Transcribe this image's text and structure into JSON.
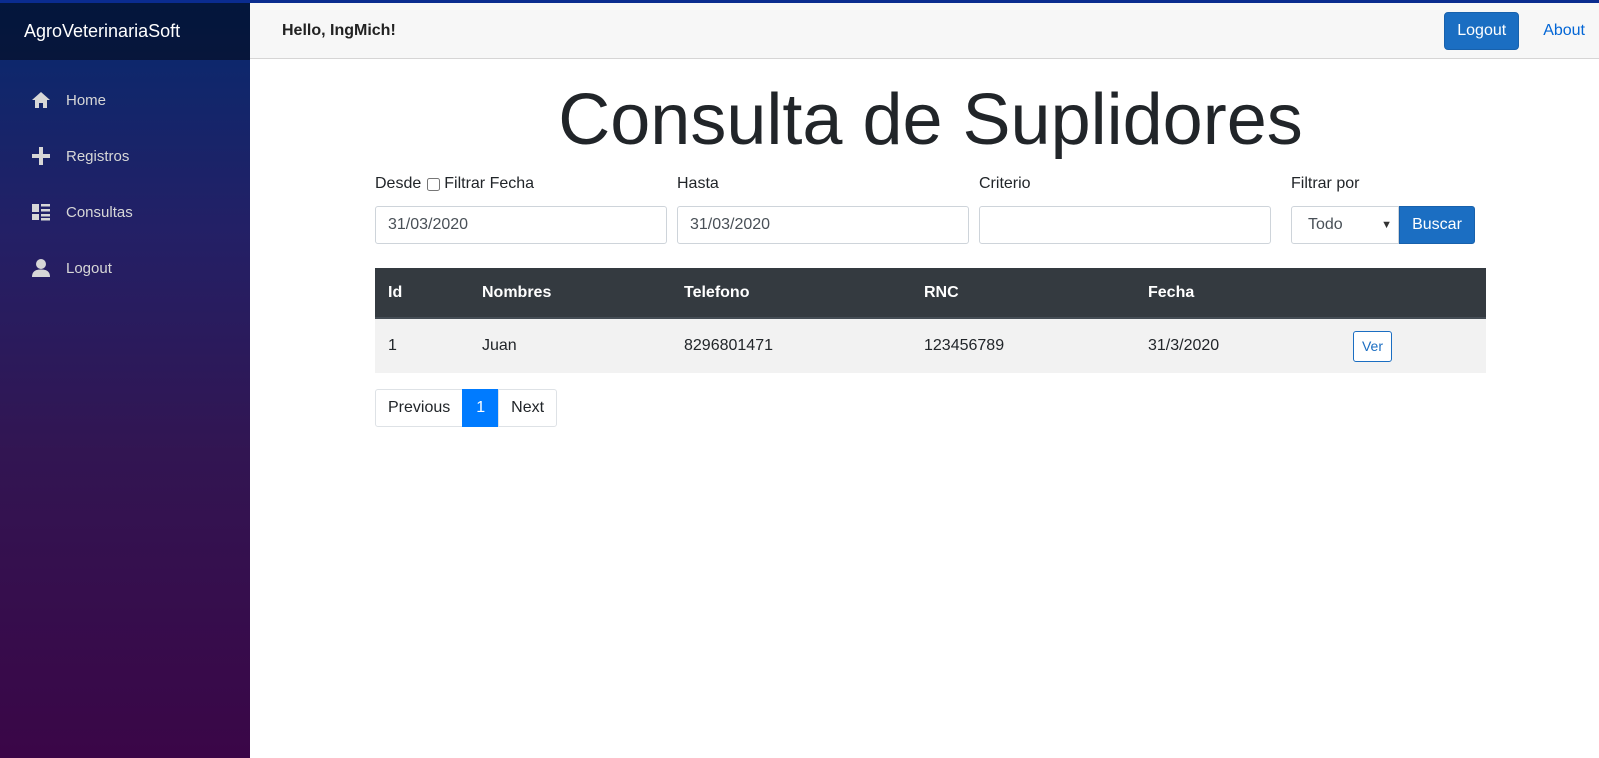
{
  "brand": "AgroVeterinariaSoft",
  "sidebar": {
    "items": [
      {
        "label": "Home",
        "icon": "home-icon"
      },
      {
        "label": "Registros",
        "icon": "plus-icon"
      },
      {
        "label": "Consultas",
        "icon": "list-icon"
      },
      {
        "label": "Logout",
        "icon": "person-icon"
      }
    ]
  },
  "topbar": {
    "greeting": "Hello, IngMich!",
    "logout_label": "Logout",
    "about_label": "About"
  },
  "page": {
    "title": "Consulta de Suplidores"
  },
  "filters": {
    "desde_label": "Desde",
    "filtrar_fecha_label": "Filtrar Fecha",
    "desde_value": "31/03/2020",
    "hasta_label": "Hasta",
    "hasta_value": "31/03/2020",
    "criterio_label": "Criterio",
    "criterio_value": "",
    "filtrar_por_label": "Filtrar por",
    "filtrar_por_selected": "Todo",
    "buscar_label": "Buscar"
  },
  "table": {
    "headers": [
      "Id",
      "Nombres",
      "Telefono",
      "RNC",
      "Fecha",
      ""
    ],
    "rows": [
      {
        "id": "1",
        "nombres": "Juan",
        "telefono": "8296801471",
        "rnc": "123456789",
        "fecha": "31/3/2020",
        "action": "Ver"
      }
    ]
  },
  "pagination": {
    "previous": "Previous",
    "current": "1",
    "next": "Next"
  },
  "colors": {
    "accent": "#1b6ec2",
    "table_header": "#343a40",
    "active_page": "#007bff"
  }
}
